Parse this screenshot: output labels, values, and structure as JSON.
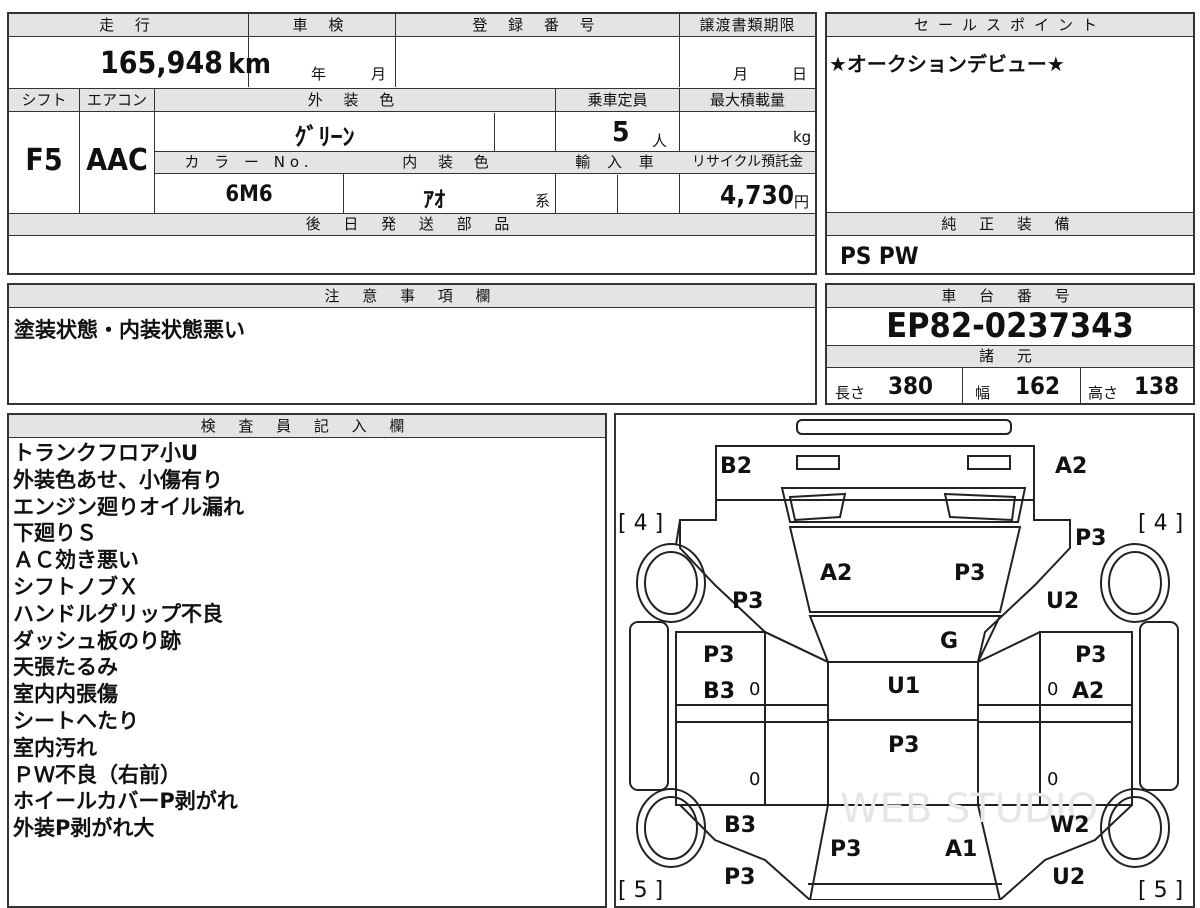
{
  "main_table": {
    "mileage": {
      "header": "走 行",
      "value": "165,948",
      "unit": "km"
    },
    "shaken": {
      "header": "車 検",
      "year_unit": "年",
      "month_unit": "月"
    },
    "registration": {
      "header": "登 録 番 号",
      "value": ""
    },
    "transfer_deadline": {
      "header": "譲渡書類期限",
      "month_unit": "月",
      "day_unit": "日"
    },
    "shift": {
      "header": "シフト",
      "value": "F5"
    },
    "aircon": {
      "header": "エアコン",
      "value": "AAC"
    },
    "exterior_color": {
      "header": "外 装 色",
      "value": "ｸﾞﾘｰﾝ"
    },
    "capacity": {
      "header": "乗車定員",
      "value": "5",
      "unit": "人"
    },
    "max_load": {
      "header": "最大積載量",
      "value": "",
      "unit": "kg"
    },
    "color_no": {
      "header": "カ ラ ー No.",
      "value": "6M6"
    },
    "interior_color": {
      "header": "内 装 色",
      "value": "ｱｵ",
      "unit": "系"
    },
    "import": {
      "header": "輸 入 車",
      "value": ""
    },
    "recycle": {
      "header": "リサイクル預託金",
      "value": "4,730",
      "unit": "円"
    },
    "later_parts": {
      "header": "後 日 発 送 部 品",
      "value": ""
    }
  },
  "sales_point": {
    "header": "セールスポイント",
    "text": "★オークションデビュー★"
  },
  "genuine_equipment": {
    "header": "純 正 装 備",
    "text": "PS PW"
  },
  "notice": {
    "header": "注 意 事 項 欄",
    "text": "塗装状態・内装状態悪い"
  },
  "chassis": {
    "header": "車 台 番 号",
    "value": "EP82-0237343"
  },
  "specs": {
    "header": "諸 元",
    "length_label": "長さ",
    "length": "380",
    "width_label": "幅",
    "width": "162",
    "height_label": "高さ",
    "height": "138"
  },
  "inspector": {
    "header": "検 査 員 記 入 欄",
    "lines": [
      "トランクフロア小U",
      "外装色あせ、小傷有り",
      "エンジン廻りオイル漏れ",
      "下廻りＳ",
      "ＡＣ効き悪い",
      "シフトノブＸ",
      "ハンドルグリップ不良",
      "ダッシュ板のり跡",
      "天張たるみ",
      "室内内張傷",
      "シートへたり",
      "室内汚れ",
      "ＰＷ不良（右前）",
      "ホイールカバーP剥がれ",
      "外装P剥がれ大"
    ]
  },
  "diagram": {
    "tire_marks": [
      "[ 4 ]",
      "[ 4 ]",
      "[ 5 ]",
      "[ 5 ]"
    ],
    "labels": {
      "rear_left": "B2",
      "rear_right": "A2",
      "trunk_left": "A2",
      "trunk_right": "P3",
      "rear_fender_left": "P3",
      "rear_fender_right": "U2",
      "rear_fender_right_top": "P3",
      "rear_glass": "G",
      "rear_door_left_1": "P3",
      "rear_door_left_2": "B3",
      "rear_door_right_1": "P3",
      "rear_door_right_2": "A2",
      "roof": "U1",
      "roof_front": "P3",
      "front_fender_left": "B3",
      "front_fender_left_2": "P3",
      "front_fender_right": "W2",
      "front_fender_right_2": "U2",
      "bonnet_left": "P3",
      "bonnet_right": "A1",
      "zero": "0"
    },
    "watermark": "WEB STUDIO"
  }
}
